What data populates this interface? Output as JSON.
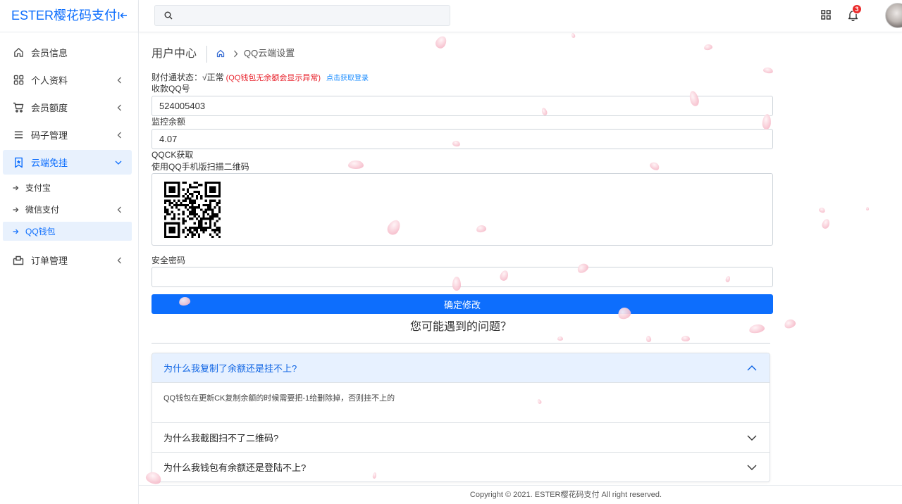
{
  "app": {
    "logo": "ESTER樱花码支付"
  },
  "header": {
    "notification_count": "3"
  },
  "sidebar": {
    "items": [
      {
        "label": "会员信息",
        "icon": "home-icon"
      },
      {
        "label": "个人资料",
        "icon": "grid-icon"
      },
      {
        "label": "会员额度",
        "icon": "cart-icon"
      },
      {
        "label": "码子管理",
        "icon": "list-icon"
      },
      {
        "label": "云端免挂",
        "icon": "bookmark-icon",
        "active": true,
        "children": [
          {
            "label": "支付宝"
          },
          {
            "label": "微信支付"
          },
          {
            "label": "QQ钱包",
            "active": true
          }
        ]
      },
      {
        "label": "订单管理",
        "icon": "order-icon"
      }
    ]
  },
  "breadcrumb": {
    "title": "用户中心",
    "current": "QQ云端设置"
  },
  "form": {
    "status_label": "财付通状态：√正常",
    "status_warning": "(QQ钱包无余额会显示异常)",
    "login_link": "点击获取登录",
    "qq_label": "收款QQ号",
    "qq_value": "524005403",
    "balance_label": "监控余额",
    "balance_value": "4.07",
    "qqck_label": "QQCK获取",
    "scan_hint": "使用QQ手机版扫描二维码",
    "password_label": "安全密码",
    "submit_label": "确定修改"
  },
  "faq": {
    "title": "您可能遇到的问题？",
    "items": [
      {
        "question": "为什么我复制了余额还是挂不上?",
        "answer": "QQ钱包在更新CK复制余额的时候需要把-1给删除掉，否则挂不上的",
        "expanded": true
      },
      {
        "question": "为什么我截图扫不了二维码?",
        "expanded": false
      },
      {
        "question": "为什么我钱包有余额还是登陆不上?",
        "expanded": false
      }
    ]
  },
  "footer": {
    "copyright": "Copyright © 2021. ESTER樱花码支付 All right reserved."
  },
  "colors": {
    "primary": "#0d6efd",
    "warning_text": "#e8202a",
    "link": "#1a8cff",
    "active_bg": "#e8f1fd",
    "badge": "#ea2b2b",
    "petal": "#f9cfd9"
  }
}
